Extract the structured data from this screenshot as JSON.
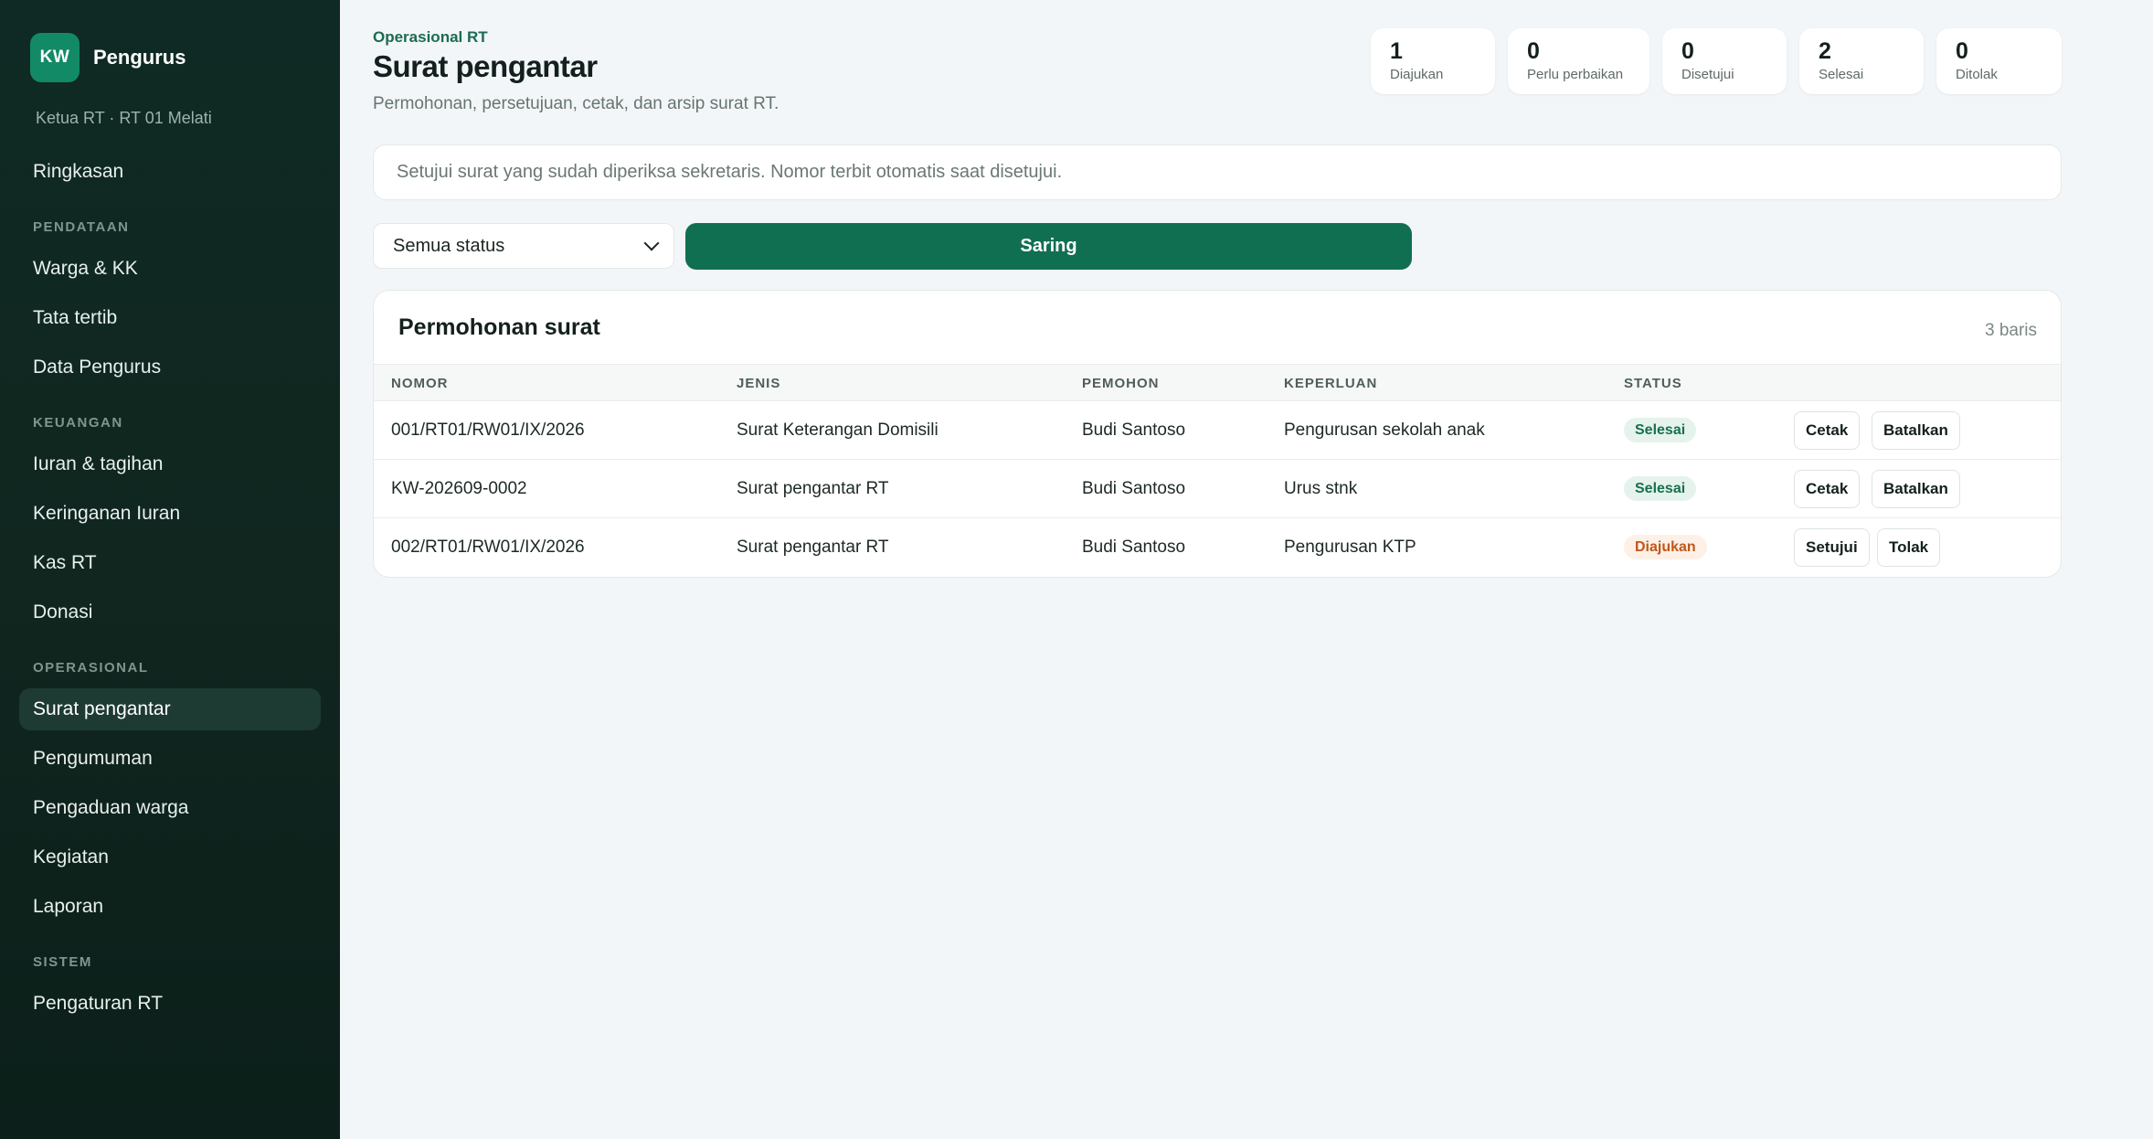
{
  "sidebar": {
    "logo": "KW",
    "brand": "Pengurus",
    "role": "Ketua RT · RT 01 Melati",
    "summary": "Ringkasan",
    "sections": {
      "pendataan": "PENDATAAN",
      "keuangan": "KEUANGAN",
      "operasional": "OPERASIONAL",
      "sistem": "SISTEM"
    },
    "items": {
      "warga": "Warga & KK",
      "tata_tertib": "Tata tertib",
      "data_pengurus": "Data Pengurus",
      "iuran": "Iuran & tagihan",
      "keringanan": "Keringanan Iuran",
      "kas": "Kas RT",
      "donasi": "Donasi",
      "surat": "Surat pengantar",
      "pengumuman": "Pengumuman",
      "pengaduan": "Pengaduan warga",
      "kegiatan": "Kegiatan",
      "laporan": "Laporan",
      "pengaturan": "Pengaturan RT"
    }
  },
  "header": {
    "eyebrow": "Operasional RT",
    "title": "Surat pengantar",
    "subtitle": "Permohonan, persetujuan, cetak, dan arsip surat RT."
  },
  "stats": [
    {
      "value": "1",
      "label": "Diajukan"
    },
    {
      "value": "0",
      "label": "Perlu perbaikan"
    },
    {
      "value": "0",
      "label": "Disetujui"
    },
    {
      "value": "2",
      "label": "Selesai"
    },
    {
      "value": "0",
      "label": "Ditolak"
    }
  ],
  "notice": "Setujui surat yang sudah diperiksa sekretaris. Nomor terbit otomatis saat disetujui.",
  "filter": {
    "selected": "Semua status",
    "button": "Saring"
  },
  "table": {
    "title": "Permohonan surat",
    "count": "3 baris",
    "headers": [
      "NOMOR",
      "JENIS",
      "PEMOHON",
      "KEPERLUAN",
      "STATUS"
    ],
    "rows": [
      {
        "nomor": "001/RT01/RW01/IX/2026",
        "jenis": "Surat Keterangan Domisili",
        "pemohon": "Budi Santoso",
        "keperluan": "Pengurusan sekolah anak",
        "status": "Selesai",
        "action1": "Cetak",
        "action2": "Batalkan"
      },
      {
        "nomor": "KW-202609-0002",
        "jenis": "Surat pengantar RT",
        "pemohon": "Budi Santoso",
        "keperluan": "Urus stnk",
        "status": "Selesai",
        "action1": "Cetak",
        "action2": "Batalkan"
      },
      {
        "nomor": "002/RT01/RW01/IX/2026",
        "jenis": "Surat pengantar RT",
        "pemohon": "Budi Santoso",
        "keperluan": "Pengurusan KTP",
        "status": "Diajukan",
        "action1": "Setujui",
        "action2": "Tolak"
      }
    ]
  },
  "colors": {
    "sidebar_bg": "#0f2a24",
    "accent": "#116f51",
    "status_done": "#17704f",
    "status_submitted": "#c0571a"
  }
}
